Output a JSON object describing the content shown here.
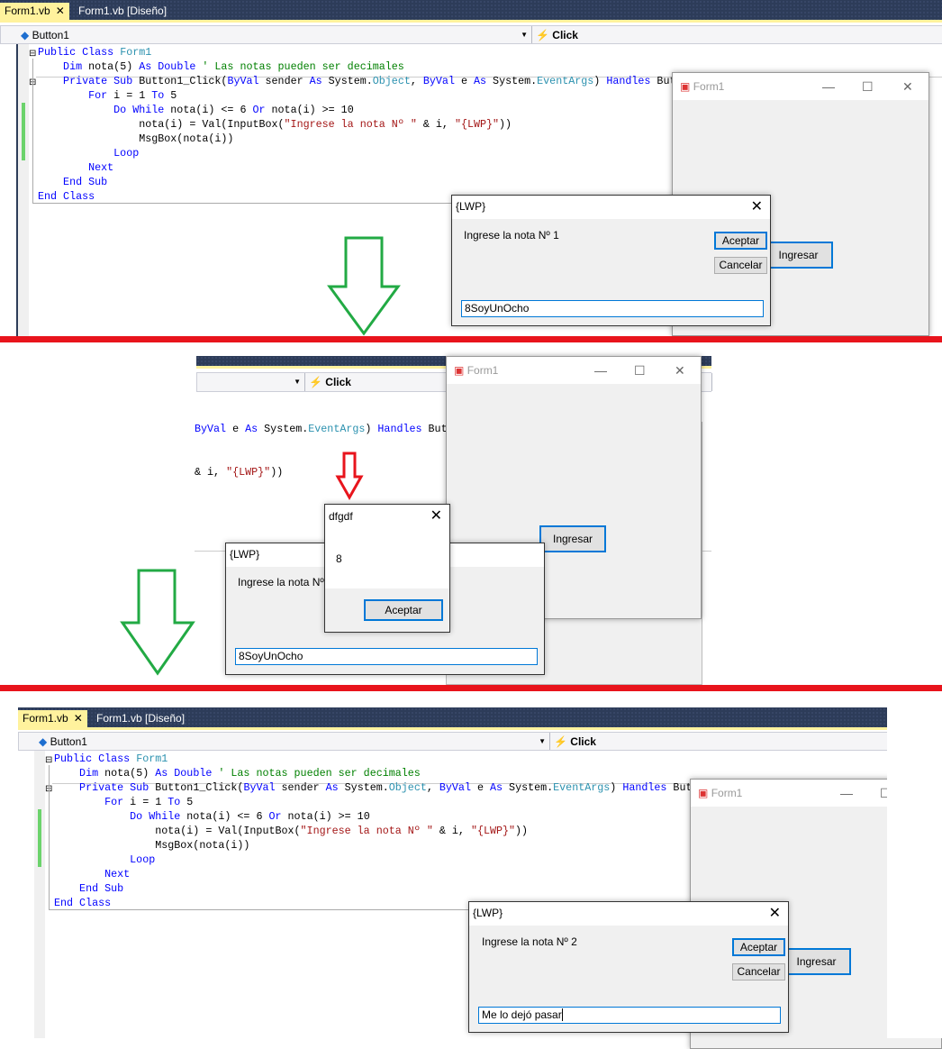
{
  "ide": {
    "tabs": [
      {
        "label": "Form1.vb",
        "active": true
      },
      {
        "label": "Form1.vb [Diseño]",
        "active": false
      }
    ],
    "class_selector": "Button1",
    "event_selector": "Click",
    "code_lines": [
      [
        [
          "Public Class ",
          "kw"
        ],
        [
          "Form1",
          "ty"
        ]
      ],
      [
        [
          "    Dim",
          "kw"
        ],
        [
          " nota(5) ",
          ""
        ],
        [
          "As Double",
          "kw"
        ],
        [
          " ' Las notas pueden ser decimales",
          "cm"
        ]
      ],
      [
        [
          "    Private Sub",
          "kw"
        ],
        [
          " Button1_Click(",
          ""
        ],
        [
          "ByVal",
          "kw"
        ],
        [
          " sender ",
          ""
        ],
        [
          "As",
          "kw"
        ],
        [
          " System.",
          ""
        ],
        [
          "Object",
          "ty"
        ],
        [
          ", ",
          ""
        ],
        [
          "ByVal",
          "kw"
        ],
        [
          " e ",
          ""
        ],
        [
          "As",
          "kw"
        ],
        [
          " System.",
          ""
        ],
        [
          "EventArgs",
          "ty"
        ],
        [
          ") ",
          ""
        ],
        [
          "Handles",
          "kw"
        ],
        [
          " But",
          ""
        ]
      ],
      [
        [
          "        For",
          "kw"
        ],
        [
          " i = 1 ",
          ""
        ],
        [
          "To",
          "kw"
        ],
        [
          " 5",
          ""
        ]
      ],
      [
        [
          "            Do While",
          "kw"
        ],
        [
          " nota(i) <= 6 ",
          ""
        ],
        [
          "Or",
          "kw"
        ],
        [
          " nota(i) >= 10",
          ""
        ]
      ],
      [
        [
          "                nota(i) = Val(InputBox(",
          ""
        ],
        [
          "\"Ingrese la nota Nº \"",
          "st"
        ],
        [
          " & i, ",
          ""
        ],
        [
          "\"{LWP}\"",
          "st"
        ],
        [
          "))",
          ""
        ]
      ],
      [
        [
          "                MsgBox(nota(i))",
          ""
        ]
      ],
      [
        [
          "            Loop",
          "kw"
        ]
      ],
      [
        [
          "        Next",
          "kw"
        ]
      ],
      [
        [
          "    End Sub",
          "kw"
        ]
      ],
      [
        [
          "End Class",
          "kw"
        ]
      ]
    ],
    "fragment_line_1": [
      [
        "ByVal",
        "kw"
      ],
      [
        " e ",
        ""
      ],
      [
        "As",
        "kw"
      ],
      [
        " System.",
        ""
      ],
      [
        "EventArgs",
        "ty"
      ],
      [
        ") ",
        ""
      ],
      [
        "Handles",
        "kw"
      ],
      [
        " But",
        ""
      ]
    ],
    "fragment_line_2": [
      [
        "& i, ",
        ""
      ],
      [
        "\"{LWP}\"",
        "st"
      ],
      [
        "))",
        ""
      ]
    ]
  },
  "form1": {
    "title": "Form1",
    "button": "Ingresar",
    "minimize": "—",
    "maximize": "☐",
    "close": "✕"
  },
  "step1": {
    "dialog": {
      "title": "{LWP}",
      "prompt": "Ingrese la nota Nº 1",
      "ok": "Aceptar",
      "cancel": "Cancelar",
      "input": "8SoyUnOcho"
    }
  },
  "step2": {
    "dialog": {
      "title": "{LWP}",
      "prompt": "Ingrese la nota Nº 1",
      "input": "8SoyUnOcho"
    },
    "msgbox": {
      "title": "dfgdf",
      "message": "8",
      "ok": "Aceptar"
    }
  },
  "step3": {
    "dialog": {
      "title": "{LWP}",
      "prompt": "Ingrese la nota Nº 2",
      "ok": "Aceptar",
      "cancel": "Cancelar",
      "input": "Me lo dejó pasar"
    }
  },
  "colors": {
    "separator": "#e8141c",
    "arrow_green": "#22aa44",
    "arrow_red": "#e8141c",
    "accent": "#0078d7"
  }
}
